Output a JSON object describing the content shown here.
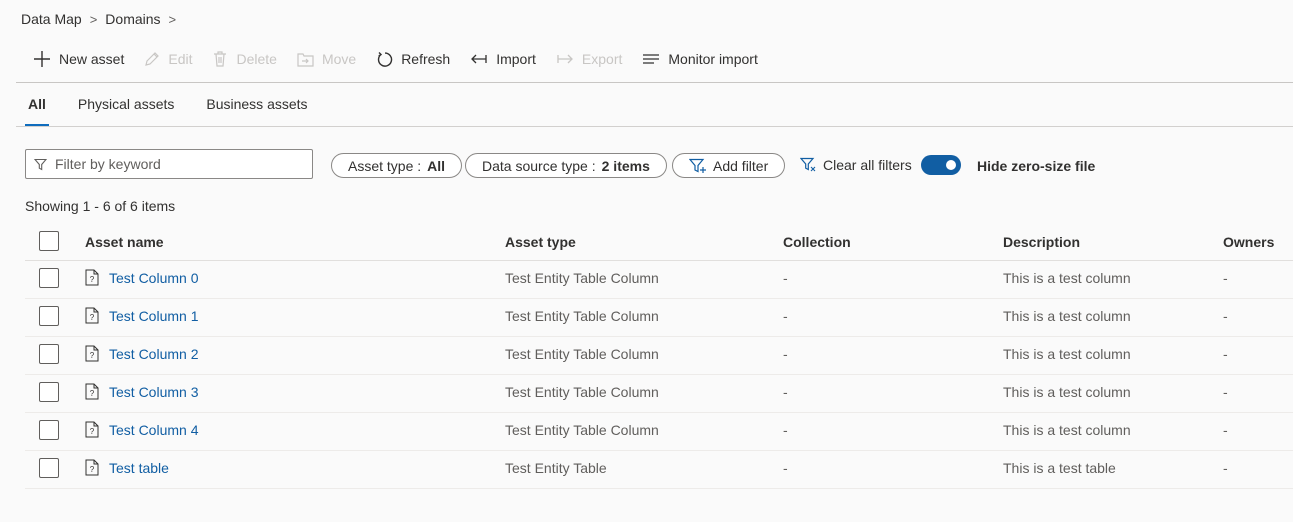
{
  "breadcrumb": {
    "items": [
      "Data Map",
      "Domains"
    ]
  },
  "toolbar": {
    "new_asset": "New asset",
    "edit": "Edit",
    "delete": "Delete",
    "move": "Move",
    "refresh": "Refresh",
    "import": "Import",
    "export": "Export",
    "monitor_import": "Monitor import"
  },
  "tabs": [
    {
      "label": "All",
      "active": true
    },
    {
      "label": "Physical assets",
      "active": false
    },
    {
      "label": "Business assets",
      "active": false
    }
  ],
  "filters": {
    "search_placeholder": "Filter by keyword",
    "asset_type_label": "Asset type : ",
    "asset_type_value": "All",
    "data_source_label": "Data source type : ",
    "data_source_value": "2 items",
    "add_filter": "Add filter",
    "clear_all": "Clear all filters",
    "hide_zero_size_label": "Hide zero-size file",
    "hide_zero_size_on": true
  },
  "showing": "Showing 1 - 6 of 6 items",
  "table": {
    "columns": [
      "Asset name",
      "Asset type",
      "Collection",
      "Description",
      "Owners"
    ],
    "rows": [
      {
        "name": "Test Column 0",
        "type": "Test Entity Table Column",
        "collection": "-",
        "description": "This is a test column",
        "owners": "-"
      },
      {
        "name": "Test Column 1",
        "type": "Test Entity Table Column",
        "collection": "-",
        "description": "This is a test column",
        "owners": "-"
      },
      {
        "name": "Test Column 2",
        "type": "Test Entity Table Column",
        "collection": "-",
        "description": "This is a test column",
        "owners": "-"
      },
      {
        "name": "Test Column 3",
        "type": "Test Entity Table Column",
        "collection": "-",
        "description": "This is a test column",
        "owners": "-"
      },
      {
        "name": "Test Column 4",
        "type": "Test Entity Table Column",
        "collection": "-",
        "description": "This is a test column",
        "owners": "-"
      },
      {
        "name": "Test table",
        "type": "Test Entity Table",
        "collection": "-",
        "description": "This is a test table",
        "owners": "-"
      }
    ]
  },
  "colors": {
    "accent": "#0f6cbd",
    "link": "#115ea3",
    "toggle": "#115ea3",
    "disabled": "#c8c6c4"
  }
}
